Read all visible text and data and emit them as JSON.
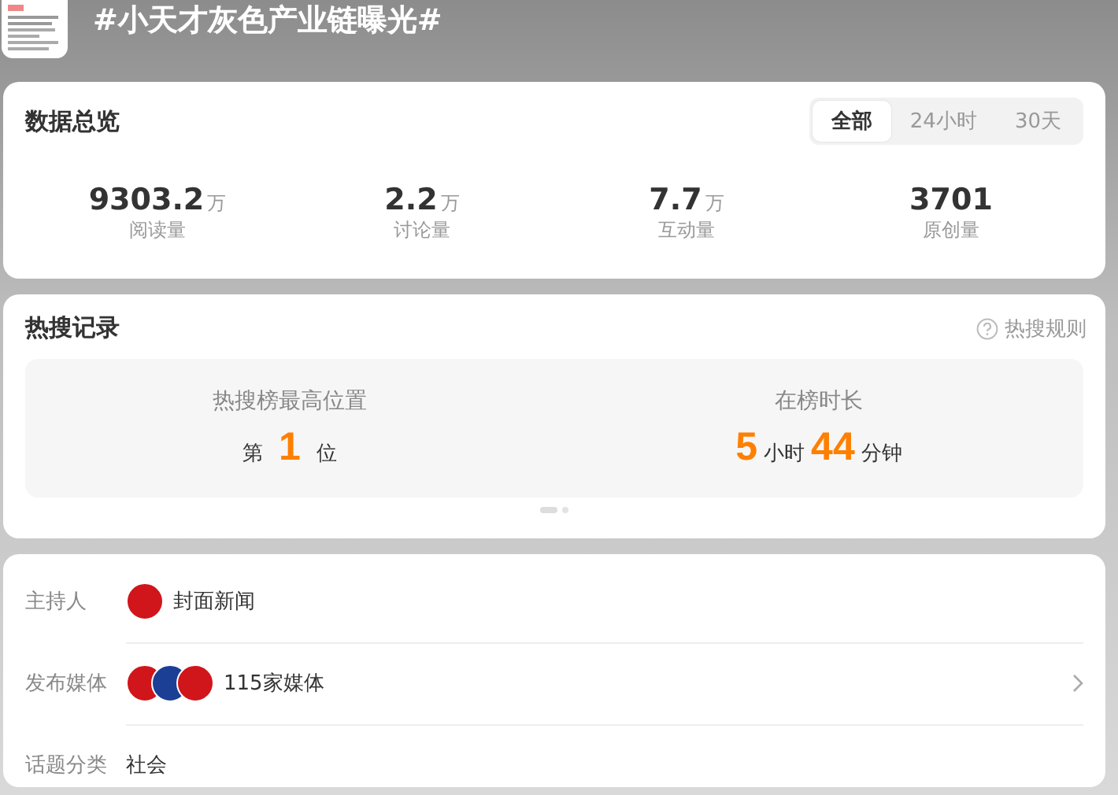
{
  "header": {
    "title": "#小天才灰色产业链曝光#"
  },
  "overview": {
    "title": "数据总览",
    "tabs": [
      {
        "label": "全部",
        "selected": true
      },
      {
        "label": "24小时",
        "selected": false
      },
      {
        "label": "30天",
        "selected": false
      }
    ],
    "stats": [
      {
        "value": "9303.2",
        "unit": "万",
        "label": "阅读量"
      },
      {
        "value": "2.2",
        "unit": "万",
        "label": "讨论量"
      },
      {
        "value": "7.7",
        "unit": "万",
        "label": "互动量"
      },
      {
        "value": "3701",
        "label": "原创量"
      }
    ]
  },
  "hot_search": {
    "title": "热搜记录",
    "rules_link": "热搜规则",
    "panels": [
      {
        "label": "热搜榜最高位置",
        "parts": [
          {
            "text": "第",
            "kind": "unit"
          },
          {
            "text": "1",
            "kind": "number"
          },
          {
            "text": "位",
            "kind": "unit"
          }
        ]
      },
      {
        "label": "在榜时长",
        "parts": [
          {
            "text": "5",
            "kind": "number"
          },
          {
            "text": "小时",
            "kind": "unit"
          },
          {
            "text": "44",
            "kind": "number"
          },
          {
            "text": "分钟",
            "kind": "unit"
          }
        ]
      }
    ],
    "pages": [
      {
        "selected": true
      },
      {
        "selected": false
      }
    ]
  },
  "info": [
    {
      "label": "主持人",
      "avatars": [
        {
          "color": "#d0161b"
        }
      ],
      "value": "封面新闻",
      "has_arrow": false
    },
    {
      "label": "发布媒体",
      "avatars": [
        {
          "color": "#d0161b"
        },
        {
          "color": "#1a3f95"
        },
        {
          "color": "#d0161b"
        }
      ],
      "value": "115家媒体",
      "has_arrow": true
    },
    {
      "label": "话题分类",
      "value": "社会",
      "has_arrow": false
    }
  ]
}
